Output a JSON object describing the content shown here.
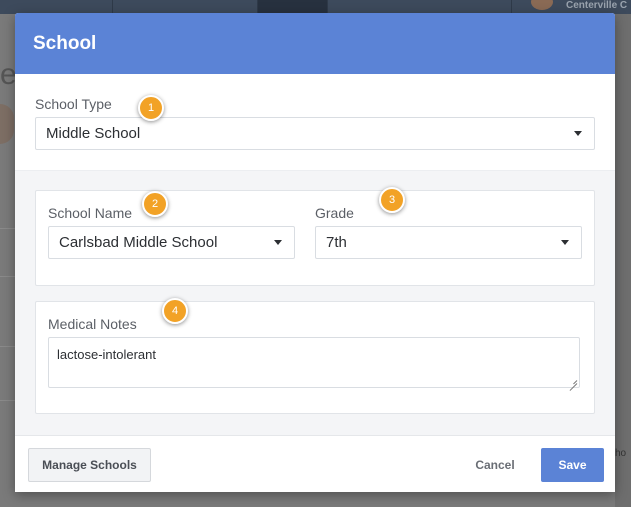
{
  "background": {
    "header_text": "Centerville C",
    "title_fragment": "es",
    "right_fragment": "ho"
  },
  "modal": {
    "title": "School",
    "school_type": {
      "label": "School Type",
      "value": "Middle School"
    },
    "school_name": {
      "label": "School Name",
      "value": "Carlsbad Middle School"
    },
    "grade": {
      "label": "Grade",
      "value": "7th"
    },
    "medical_notes": {
      "label": "Medical Notes",
      "value": "lactose-intolerant"
    },
    "footer": {
      "manage_label": "Manage Schools",
      "cancel_label": "Cancel",
      "save_label": "Save"
    }
  },
  "badges": [
    "1",
    "2",
    "3",
    "4"
  ],
  "colors": {
    "accent": "#5b83d6",
    "badge": "#f2a226"
  }
}
